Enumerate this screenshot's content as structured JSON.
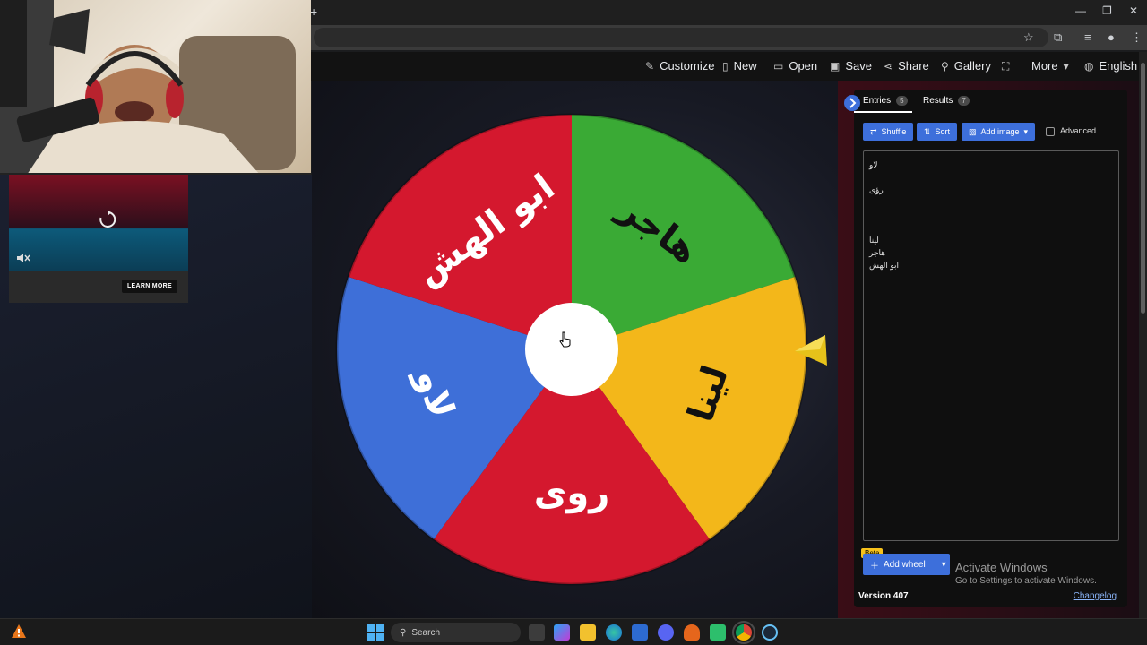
{
  "browser": {
    "new_tab": "+",
    "window_controls": [
      "—",
      "❐",
      "✕"
    ]
  },
  "header": {
    "menu": [
      {
        "label": "Customize",
        "icon": "palette-icon",
        "glyph": "🎨"
      },
      {
        "label": "New",
        "icon": "file-icon",
        "glyph": "🗋"
      },
      {
        "label": "Open",
        "icon": "folder-open-icon",
        "glyph": "🗁"
      },
      {
        "label": "Save",
        "icon": "save-icon",
        "glyph": "💾"
      },
      {
        "label": "Share",
        "icon": "share-icon",
        "glyph": "⇗"
      },
      {
        "label": "Gallery",
        "icon": "search-icon",
        "glyph": "🔍"
      },
      {
        "label": "",
        "icon": "fullscreen-icon",
        "glyph": "⛶"
      },
      {
        "label": "More",
        "icon": "chevron-down-icon",
        "glyph": "▾"
      },
      {
        "label": "English",
        "icon": "globe-icon",
        "glyph": "🌐"
      }
    ]
  },
  "ad": {
    "learn_more": "LEARN MORE"
  },
  "wheel": {
    "segments": [
      {
        "label": "هاجر",
        "color": "#3aaa35"
      },
      {
        "label": "لينا",
        "color": "#f3b71a"
      },
      {
        "label": "روى",
        "color": "#d4182e"
      },
      {
        "label": "لاو",
        "color": "#3e6fd8"
      },
      {
        "label": "ابو الهش",
        "color": "#d4182e"
      }
    ]
  },
  "panel": {
    "tabs": {
      "entries": {
        "label": "Entries",
        "count": "5"
      },
      "results": {
        "label": "Results",
        "count": "7"
      }
    },
    "buttons": {
      "shuffle": "Shuffle",
      "sort": "Sort",
      "add_image": "Add image",
      "advanced": "Advanced",
      "add_wheel": "Add wheel",
      "beta": "Beta"
    },
    "entries": [
      "لاو",
      "",
      "رؤى",
      "",
      "",
      "",
      "لينا",
      "هاجر",
      "ابو الهش"
    ],
    "version": "Version 407",
    "changelog": "Changelog"
  },
  "windows": {
    "activate_title": "Activate Windows",
    "activate_sub": "Go to Settings to activate Windows."
  },
  "taskbar": {
    "search": "Search"
  }
}
